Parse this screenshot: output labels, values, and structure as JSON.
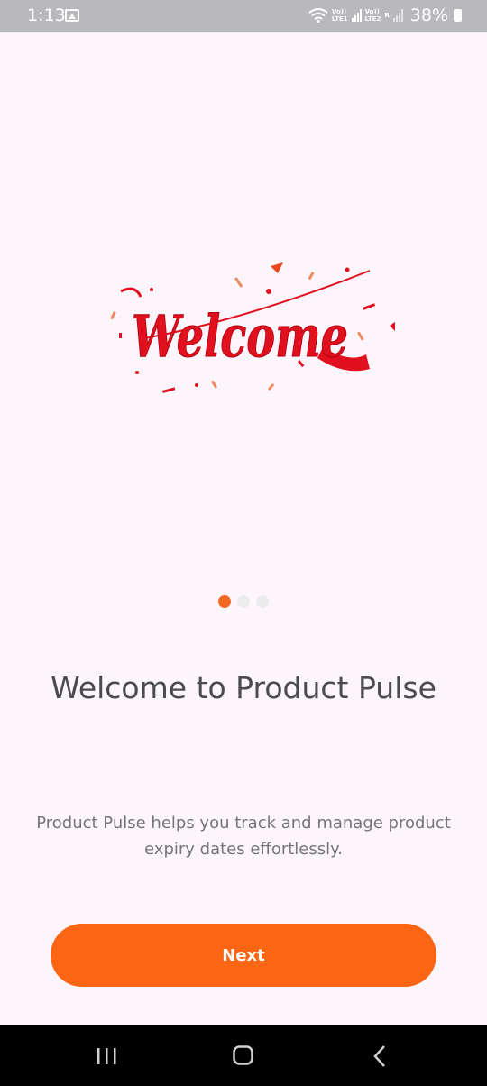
{
  "status_bar": {
    "time": "1:13",
    "lte1_top": "Vo))",
    "lte1_bottom": "LTE1",
    "lte2_top": "Vo))",
    "lte2_bottom": "LTE2",
    "roaming": "R",
    "battery": "38%",
    "icons": [
      "gallery-icon",
      "wifi-icon",
      "signal-icon",
      "battery-icon"
    ]
  },
  "illustration": {
    "text": "Welcome",
    "color": "#e0101e"
  },
  "pager": {
    "count": 3,
    "active_index": 0,
    "active_color": "#f26722"
  },
  "onboarding": {
    "title": "Welcome to Product Pulse",
    "subtitle": "Product Pulse helps you track and manage product expiry dates effortlessly."
  },
  "actions": {
    "next_label": "Next",
    "accent": "#fb6514"
  },
  "nav_bar": {
    "icons": [
      "recents-icon",
      "home-icon",
      "back-icon"
    ]
  }
}
